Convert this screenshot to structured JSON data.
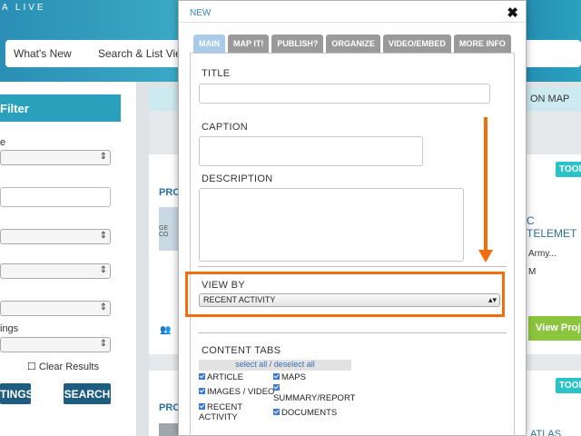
{
  "background": {
    "logo_text": "A LIVE",
    "nav": {
      "whats_new": "What's New",
      "search_list": "Search & List View"
    },
    "filter": {
      "header": "Filter",
      "label_e": "e",
      "label_ings": "ings",
      "clear_results": "Clear Results",
      "tings_button": "TINGS",
      "search_button": "SEARCH"
    },
    "right": {
      "on_map": "ON MAP",
      "tool_tag": "TOOl",
      "pro_label": "PRO",
      "telemetry": "C TELEMET",
      "army": "Army...",
      "m": "M",
      "img_caption": "GE CO",
      "view_project": "View Proj",
      "atlas": "ATLAS MAI"
    }
  },
  "modal": {
    "title": "NEW",
    "close_glyph": "✖",
    "tabs": [
      {
        "label": "MAIN",
        "active": true
      },
      {
        "label": "MAP IT!",
        "active": false
      },
      {
        "label": "PUBLISH?",
        "active": false
      },
      {
        "label": "ORGANIZE",
        "active": false
      },
      {
        "label": "VIDEO/EMBED",
        "active": false
      },
      {
        "label": "MORE INFO",
        "active": false
      }
    ],
    "title_label": "TITLE",
    "title_value": "",
    "caption_label": "CAPTION",
    "caption_value": "",
    "description_label": "DESCRIPTION",
    "description_value": "",
    "view_by_label": "VIEW BY",
    "view_by_value": "RECENT ACTIVITY",
    "content_tabs_label": "CONTENT TABS",
    "select_all": "select all / deselect all",
    "checkboxes": {
      "article": "ARTICLE",
      "maps": "MAPS",
      "images_video": "IMAGES / VIDEO",
      "summary_report": "SUMMARY/REPORT",
      "recent_activity_1": "RECENT",
      "recent_activity_2": "ACTIVITY",
      "documents": "DOCUMENTS"
    },
    "annotation_color": "#f26d0c"
  }
}
